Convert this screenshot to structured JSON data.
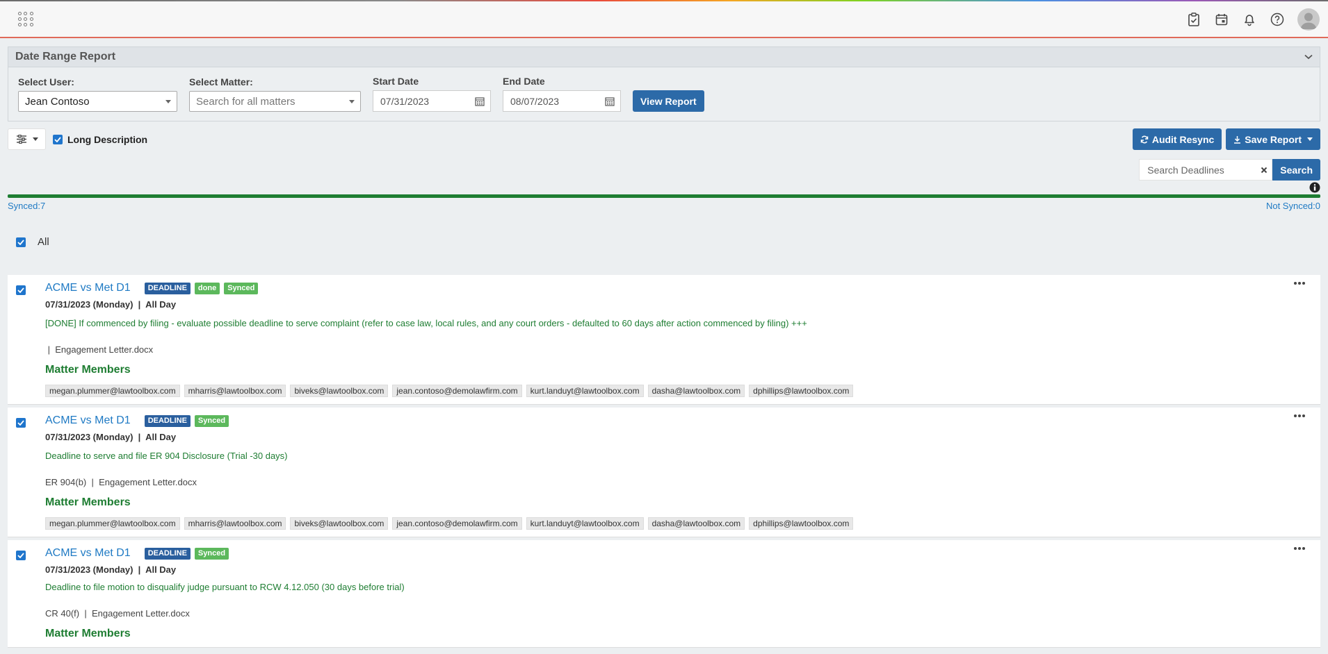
{
  "app": {
    "top_icons": [
      "apps-grid-icon",
      "clipboard-check-icon",
      "calendar-icon",
      "bell-icon",
      "help-icon",
      "avatar"
    ]
  },
  "report": {
    "title": "Date Range Report",
    "select_user_label": "Select User:",
    "select_user_value": "Jean Contoso",
    "select_matter_label": "Select Matter:",
    "select_matter_placeholder": "Search for all matters",
    "start_date_label": "Start Date",
    "start_date_value": "07/31/2023",
    "end_date_label": "End Date",
    "end_date_value": "08/07/2023",
    "view_report_label": "View Report"
  },
  "toolbar": {
    "long_description_label": "Long Description",
    "audit_resync_label": "Audit Resync",
    "save_report_label": "Save Report"
  },
  "search": {
    "placeholder": "Search Deadlines",
    "button_label": "Search"
  },
  "sync": {
    "synced_label": "Synced:7",
    "not_synced_label": "Not Synced:0",
    "progress_fraction": 1.0
  },
  "select_all_label": "All",
  "members_title": "Matter Members",
  "cards": [
    {
      "matter": "ACME vs Met D1",
      "badges": [
        "DEADLINE",
        "done",
        "Synced"
      ],
      "date": "07/31/2023 (Monday)",
      "time": "All Day",
      "description": "[DONE] If commenced by filing - evaluate possible deadline to serve complaint (refer to case law, local rules, and any court orders - defaulted to 60 days after action commenced by filing) +++",
      "rule": "",
      "document": "Engagement Letter.docx",
      "members": [
        "megan.plummer@lawtoolbox.com",
        "mharris@lawtoolbox.com",
        "biveks@lawtoolbox.com",
        "jean.contoso@demolawfirm.com",
        "kurt.landuyt@lawtoolbox.com",
        "dasha@lawtoolbox.com",
        "dphillips@lawtoolbox.com"
      ]
    },
    {
      "matter": "ACME vs Met D1",
      "badges": [
        "DEADLINE",
        "Synced"
      ],
      "date": "07/31/2023 (Monday)",
      "time": "All Day",
      "description": "Deadline to serve and file ER 904 Disclosure (Trial -30 days)",
      "rule": "ER 904(b)",
      "document": "Engagement Letter.docx",
      "members": [
        "megan.plummer@lawtoolbox.com",
        "mharris@lawtoolbox.com",
        "biveks@lawtoolbox.com",
        "jean.contoso@demolawfirm.com",
        "kurt.landuyt@lawtoolbox.com",
        "dasha@lawtoolbox.com",
        "dphillips@lawtoolbox.com"
      ]
    },
    {
      "matter": "ACME vs Met D1",
      "badges": [
        "DEADLINE",
        "Synced"
      ],
      "date": "07/31/2023 (Monday)",
      "time": "All Day",
      "description": "Deadline to file motion to disqualify judge pursuant to RCW 4.12.050 (30 days before trial)",
      "rule": "CR 40(f)",
      "document": "Engagement Letter.docx",
      "members": []
    }
  ]
}
